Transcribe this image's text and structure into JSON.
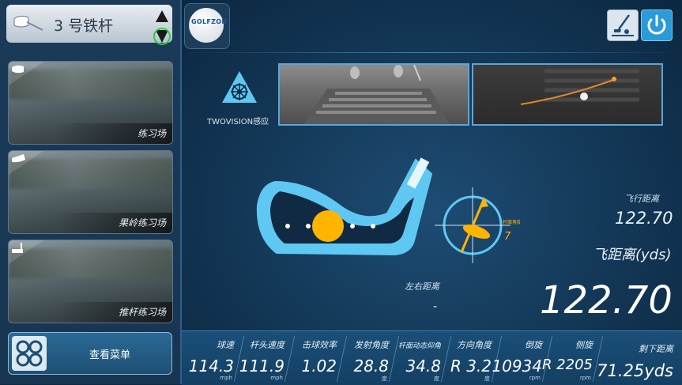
{
  "club": {
    "name": "3 号铁杆"
  },
  "courses": [
    {
      "label": "练习场"
    },
    {
      "label": "果岭练习场"
    },
    {
      "label": "推杆练习场"
    }
  ],
  "menu": {
    "label": "查看菜单"
  },
  "logo": {
    "text": "GOLFZON"
  },
  "sensor": {
    "label": "TWOVISION感应"
  },
  "club_angle": {
    "label": "杆面角度",
    "value": "7"
  },
  "carry": {
    "label": "飞行距离",
    "value": "122.70"
  },
  "distance": {
    "label": "飞距离(yds)",
    "value": "122.70"
  },
  "side": {
    "label": "左右距离",
    "value": "-"
  },
  "stats": [
    {
      "label": "球速",
      "value": "114.3",
      "unit": "mph"
    },
    {
      "label": "杆头速度",
      "value": "111.9",
      "unit": "mph"
    },
    {
      "label": "击球效率",
      "value": "1.02",
      "unit": ""
    },
    {
      "label": "发射角度",
      "value": "28.8",
      "unit": "度"
    },
    {
      "label": "杆面动态仰角",
      "value": "34.8",
      "unit": "度"
    },
    {
      "label": "方向角度",
      "value": "R 3.2",
      "unit": "度"
    },
    {
      "label": "倒旋",
      "value": "10934",
      "unit": "rpm"
    },
    {
      "label": "侧旋",
      "value": "R 2205",
      "unit": "rpm"
    },
    {
      "label": "剩下距离",
      "value": "71.25yds",
      "unit": ""
    }
  ],
  "colors": {
    "accent": "#5ec8f2",
    "ball": "#ffb400",
    "panel": "#1a3a58"
  }
}
